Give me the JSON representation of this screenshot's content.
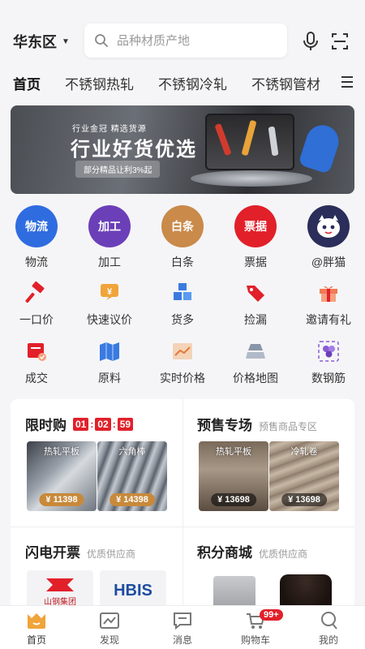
{
  "header": {
    "region": "华东区",
    "search_placeholder": "品种材质产地"
  },
  "tabs": [
    "首页",
    "不锈钢热轧",
    "不锈钢冷轧",
    "不锈钢管材"
  ],
  "banner": {
    "small_text": "行业金冠 精选货源",
    "headline": "行业好货优选",
    "pill": "部分精品让利3%起"
  },
  "services": [
    {
      "label": "物流",
      "circle_text": "物流",
      "color": "#2f6ce0"
    },
    {
      "label": "加工",
      "circle_text": "加工",
      "color": "#6b3fb8"
    },
    {
      "label": "白条",
      "circle_text": "白条",
      "color": "#c98a4a"
    },
    {
      "label": "票据",
      "circle_text": "票据",
      "color": "#e1202a"
    },
    {
      "label": "@胖猫",
      "circle_text": "",
      "color": "#2b2d5a"
    }
  ],
  "quick_row1": [
    {
      "label": "一口价",
      "icon": "gavel-icon"
    },
    {
      "label": "快速议价",
      "icon": "yen-chat-icon"
    },
    {
      "label": "货多",
      "icon": "boxes-icon"
    },
    {
      "label": "捡漏",
      "icon": "tag-icon"
    },
    {
      "label": "邀请有礼",
      "icon": "gift-icon"
    }
  ],
  "quick_row2": [
    {
      "label": "成交",
      "icon": "deal-icon"
    },
    {
      "label": "原料",
      "icon": "map-icon"
    },
    {
      "label": "实时价格",
      "icon": "chart-icon"
    },
    {
      "label": "价格地图",
      "icon": "ingot-icon"
    },
    {
      "label": "数钢筋",
      "icon": "rebar-icon"
    }
  ],
  "flash_sale": {
    "title": "限时购",
    "timer": [
      "01",
      "02",
      "59"
    ],
    "items": [
      {
        "name": "热轧平板",
        "price": "¥ 11398"
      },
      {
        "name": "六角棒",
        "price": "¥ 14398"
      }
    ]
  },
  "presale": {
    "title": "预售专场",
    "subtitle": "预售商品专区",
    "items": [
      {
        "name": "热轧平板",
        "price": "¥ 13698"
      },
      {
        "name": "冷轧卷",
        "price": "¥ 13698"
      }
    ]
  },
  "invoice": {
    "title": "闪电开票",
    "subtitle": "优质供应商",
    "logos": [
      "山钢集团",
      "HBIS"
    ]
  },
  "points": {
    "title": "积分商城",
    "subtitle": "优质供应商"
  },
  "bottom_nav": [
    {
      "label": "首页",
      "icon": "home-icon"
    },
    {
      "label": "发现",
      "icon": "discover-icon"
    },
    {
      "label": "消息",
      "icon": "message-icon"
    },
    {
      "label": "购物车",
      "icon": "cart-icon",
      "badge": "99+"
    },
    {
      "label": "我的",
      "icon": "profile-icon"
    }
  ]
}
